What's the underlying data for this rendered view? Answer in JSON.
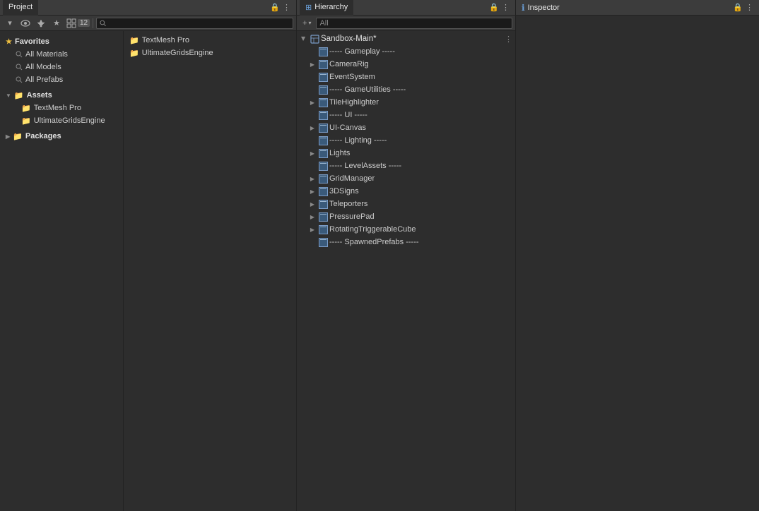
{
  "project_tab": {
    "label": "Project",
    "icon": "◉"
  },
  "toolbar": {
    "search_placeholder": "",
    "badge_count": "12"
  },
  "favorites": {
    "label": "Favorites",
    "items": [
      {
        "label": "All Materials"
      },
      {
        "label": "All Models"
      },
      {
        "label": "All Prefabs"
      }
    ]
  },
  "assets": {
    "label": "Assets",
    "children": [
      {
        "label": "TextMesh Pro",
        "type": "folder"
      },
      {
        "label": "UltimateGridsEngine",
        "type": "folder"
      }
    ],
    "sub_items": [
      {
        "label": "TextMesh Pro",
        "type": "folder"
      },
      {
        "label": "UltimateGridsEngine",
        "type": "folder"
      }
    ]
  },
  "packages": {
    "label": "Packages"
  },
  "assets_panel": {
    "items": [
      {
        "label": "TextMesh Pro",
        "type": "folder"
      },
      {
        "label": "UltimateGridsEngine",
        "type": "folder"
      }
    ]
  },
  "hierarchy": {
    "tab_label": "Hierarchy",
    "search_placeholder": "All",
    "add_button": "+",
    "root": "Sandbox-Main*",
    "items": [
      {
        "label": "----- Gameplay -----",
        "indent": 1,
        "has_arrow": false,
        "is_separator": true
      },
      {
        "label": "CameraRig",
        "indent": 1,
        "has_arrow": true
      },
      {
        "label": "EventSystem",
        "indent": 1,
        "has_arrow": false
      },
      {
        "label": "----- GameUtilities -----",
        "indent": 1,
        "has_arrow": false,
        "is_separator": true
      },
      {
        "label": "TileHighlighter",
        "indent": 1,
        "has_arrow": true
      },
      {
        "label": "----- UI -----",
        "indent": 1,
        "has_arrow": false,
        "is_separator": true
      },
      {
        "label": "UI-Canvas",
        "indent": 1,
        "has_arrow": true
      },
      {
        "label": "----- Lighting -----",
        "indent": 1,
        "has_arrow": false,
        "is_separator": true
      },
      {
        "label": "Lights",
        "indent": 1,
        "has_arrow": true
      },
      {
        "label": "----- LevelAssets -----",
        "indent": 1,
        "has_arrow": false,
        "is_separator": true
      },
      {
        "label": "GridManager",
        "indent": 1,
        "has_arrow": true
      },
      {
        "label": "3DSigns",
        "indent": 1,
        "has_arrow": true
      },
      {
        "label": "Teleporters",
        "indent": 1,
        "has_arrow": true
      },
      {
        "label": "PressurePad",
        "indent": 1,
        "has_arrow": true
      },
      {
        "label": "RotatingTriggerableCube",
        "indent": 1,
        "has_arrow": true
      },
      {
        "label": "----- SpawnedPrefabs -----",
        "indent": 1,
        "has_arrow": false,
        "is_separator": true
      }
    ]
  },
  "inspector": {
    "tab_label": "Inspector",
    "icon": "ℹ"
  },
  "controls": {
    "lock_icon": "🔒",
    "more_icon": "⋮",
    "pin_icon": "📌",
    "eye_icon": "👁",
    "star_icon": "★",
    "search_icon": "🔍"
  }
}
